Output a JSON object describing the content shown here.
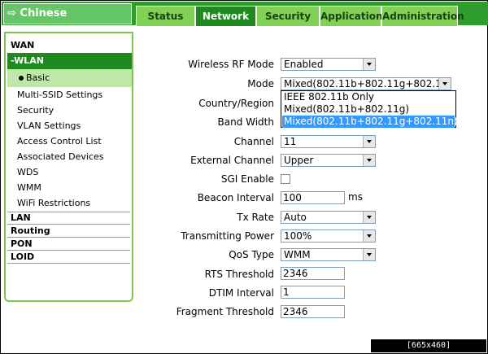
{
  "header": {
    "language": "⇨ Chinese",
    "tabs": [
      {
        "label": "Status"
      },
      {
        "label": "Network"
      },
      {
        "label": "Security"
      },
      {
        "label": "Application"
      },
      {
        "label": "Administration"
      }
    ],
    "active_tab": "Network"
  },
  "sidebar": {
    "wan": "WAN",
    "wlan": "-WLAN",
    "basic": "Basic",
    "items": [
      {
        "label": "Multi-SSID Settings"
      },
      {
        "label": "Security"
      },
      {
        "label": "VLAN Settings"
      },
      {
        "label": "Access Control List"
      },
      {
        "label": "Associated Devices"
      },
      {
        "label": "WDS"
      },
      {
        "label": "WMM"
      },
      {
        "label": "WiFi Restrictions"
      }
    ],
    "lan": "LAN",
    "routing": "Routing",
    "pon": "PON",
    "loid": "LOID"
  },
  "form": {
    "rf_mode": {
      "label": "Wireless RF Mode",
      "value": "Enabled"
    },
    "mode": {
      "label": "Mode",
      "value": "Mixed(802.11b+802.11g+802.11n)"
    },
    "country": {
      "label": "Country/Region"
    },
    "bandwidth": {
      "label": "Band Width"
    },
    "channel": {
      "label": "Channel",
      "value": "11"
    },
    "ext_channel": {
      "label": "External Channel",
      "value": "Upper"
    },
    "sgi": {
      "label": "SGI Enable",
      "checked": false
    },
    "beacon": {
      "label": "Beacon Interval",
      "value": "100",
      "unit": "ms"
    },
    "tx_rate": {
      "label": "Tx Rate",
      "value": "Auto"
    },
    "tx_power": {
      "label": "Transmitting Power",
      "value": "100%"
    },
    "qos": {
      "label": "QoS Type",
      "value": "WMM"
    },
    "rts": {
      "label": "RTS Threshold",
      "value": "2346"
    },
    "dtim": {
      "label": "DTIM Interval",
      "value": "1"
    },
    "fragment": {
      "label": "Fragment Threshold",
      "value": "2346"
    }
  },
  "mode_dropdown": {
    "options": [
      {
        "label": "IEEE 802.11b Only"
      },
      {
        "label": "Mixed(802.11b+802.11g)"
      },
      {
        "label": "Mixed(802.11b+802.11g+802.11n)"
      }
    ],
    "highlighted": "Mixed(802.11b+802.11g+802.11n)"
  },
  "watermark": "[665x460] http://upic.me/",
  "colors": {
    "brand_green": "#2e9d2e",
    "active_tab": "#1f8a1f",
    "highlight": "#3399ff"
  }
}
